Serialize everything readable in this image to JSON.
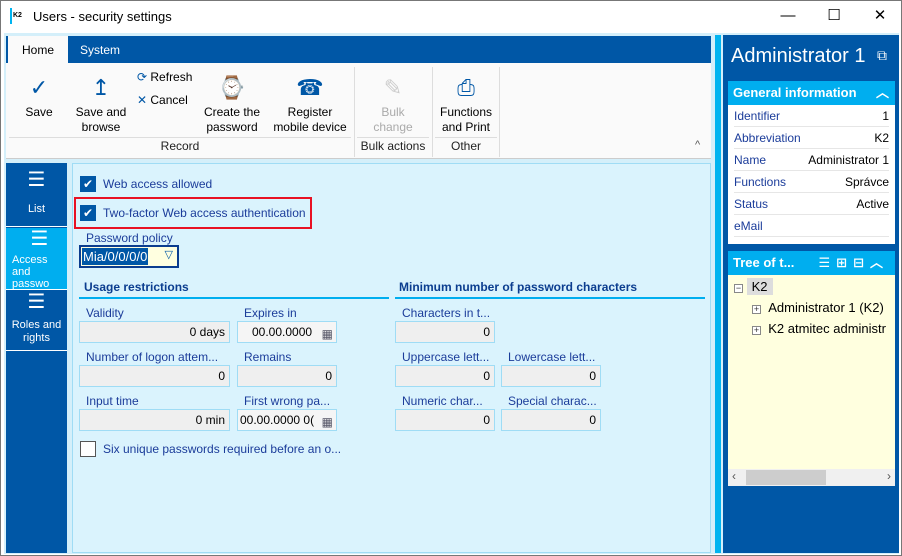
{
  "window": {
    "title": "Users - security settings",
    "logo": "K2"
  },
  "ribbon": {
    "tabs": [
      {
        "label": "Home",
        "active": true
      },
      {
        "label": "System",
        "active": false
      }
    ],
    "buttons": {
      "save": "Save",
      "save_browse": "Save and browse",
      "refresh": "Refresh",
      "cancel": "Cancel",
      "create_password": "Create the password",
      "register_mobile": "Register mobile device",
      "bulk_change": "Bulk change",
      "functions_print": "Functions and Print"
    },
    "groups": {
      "record": "Record",
      "bulk": "Bulk actions",
      "other": "Other"
    }
  },
  "nav": [
    {
      "label": "List"
    },
    {
      "label": "Access and passwo"
    },
    {
      "label": "Roles and rights"
    }
  ],
  "form": {
    "web_access": {
      "label": "Web access allowed",
      "checked": true
    },
    "two_factor": {
      "label": "Two-factor Web access authentication",
      "checked": true,
      "highlight_color": "#e81123"
    },
    "password_policy": {
      "label": "Password policy",
      "value": "Mia/0/0/0/0"
    },
    "usage": {
      "title": "Usage restrictions",
      "validity": {
        "label": "Validity",
        "value": "0 days"
      },
      "expires": {
        "label": "Expires in",
        "value": "00.00.0000"
      },
      "logon_attempts": {
        "label": "Number of logon attem...",
        "value": "0"
      },
      "remains": {
        "label": "Remains",
        "value": "0"
      },
      "input_time": {
        "label": "Input time",
        "value": "0 min"
      },
      "first_wrong": {
        "label": "First wrong pa...",
        "value": "00.00.0000 0("
      }
    },
    "six_unique": {
      "label": "Six unique passwords required before an o...",
      "checked": false
    },
    "minchars": {
      "title": "Minimum number of password characters",
      "total": {
        "label": "Characters in t...",
        "value": "0"
      },
      "upper": {
        "label": "Uppercase lett...",
        "value": "0"
      },
      "lower": {
        "label": "Lowercase lett...",
        "value": "0"
      },
      "numeric": {
        "label": "Numeric char...",
        "value": "0"
      },
      "special": {
        "label": "Special charac...",
        "value": "0"
      }
    }
  },
  "right": {
    "title": "Administrator 1",
    "general": {
      "title": "General information",
      "rows": [
        {
          "k": "Identifier",
          "v": "1"
        },
        {
          "k": "Abbreviation",
          "v": "K2"
        },
        {
          "k": "Name",
          "v": "Administrator 1"
        },
        {
          "k": "Functions",
          "v": "Správce"
        },
        {
          "k": "Status",
          "v": "Active"
        },
        {
          "k": "eMail",
          "v": ""
        }
      ]
    },
    "tree": {
      "title": "Tree of t...",
      "root": "K2",
      "children": [
        "Administrator 1 (K2)",
        "K2 atmitec administr"
      ]
    }
  },
  "colors": {
    "brand": "#0057a6",
    "accent": "#00aeef",
    "panel": "#daf3fd"
  }
}
